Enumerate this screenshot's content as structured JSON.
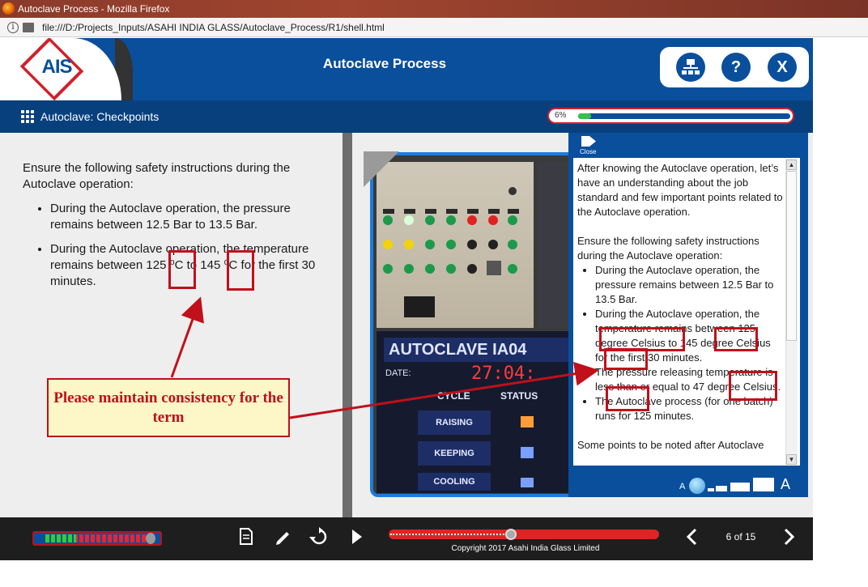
{
  "browser": {
    "title": "Autoclave Process - Mozilla Firefox",
    "url": "file:///D:/Projects_Inputs/ASAHI INDIA GLASS/Autoclave_Process/R1/shell.html"
  },
  "header": {
    "logo_text": "AIS",
    "title": "Autoclave Process",
    "help_label": "?",
    "exit_label": "X"
  },
  "subbar": {
    "title": "Autoclave: Checkpoints",
    "progress_label": "6%",
    "progress_fraction": 0.06
  },
  "main": {
    "intro": "Ensure the following safety instructions during the Autoclave operation:",
    "bullets": {
      "b1": "During the Autoclave operation, the pressure remains between 12.5 Bar to 13.5 Bar.",
      "b2_a": "During the Autoclave operation, the temperature remains between 125 ",
      "b2_unit1": "⁰C",
      "b2_b": " to 145 ",
      "b2_unit2": "⁰C",
      "b2_c": " for the first 30 minutes."
    },
    "photo": {
      "sign": "AUTOCLAVE IA04",
      "date_label": "DATE:",
      "date_value": "27:04:",
      "status_header": "STATUS",
      "cycle_header": "CYCLE",
      "rows": [
        "RAISING",
        "KEEPING",
        "COOLING"
      ]
    }
  },
  "transcript": {
    "close_label": "Close",
    "p1": "After knowing the Autoclave operation, let’s have an understanding about the job standard and few important points related to the Autoclave operation.",
    "p2": "Ensure the following safety instructions during the Autoclave operation:",
    "items": {
      "i1": "During the Autoclave operation, the pressure remains between 12.5 Bar to 13.5 Bar.",
      "i2": "During the Autoclave operation, the temperature remains between 125 degree Celsius to 145 degree Celsius for the first 30 minutes.",
      "i3": "The pressure releasing temperature is less than or equal to 47 degree Celsius.",
      "i4": "The Autoclave process (for one batch) runs for 125 minutes."
    },
    "p3": "Some points to be noted after Autoclave",
    "zoom_small": "A",
    "zoom_big": "A"
  },
  "annotation": {
    "callout": "Please maintain consistency for the term"
  },
  "footer": {
    "copyright": "Copyright 2017 Asahi India Glass Limited",
    "page_count": "6 of 15",
    "seek_fraction": 0.43
  },
  "colors": {
    "brand_blue": "#0a4f9c",
    "accent_red": "#c0101a",
    "progress_green": "#33c24a"
  }
}
